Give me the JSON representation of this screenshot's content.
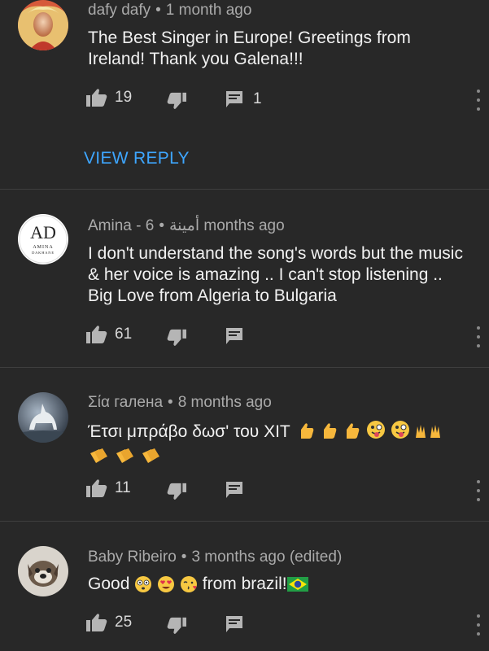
{
  "comments": [
    {
      "author": "dafy dafy",
      "time": "1 month ago",
      "text": "The Best Singer in Europe! Greetings from Ireland! Thank you Galena!!!",
      "likes": "19",
      "replies": "1",
      "view_reply": "VIEW REPLY",
      "avatar_icon": "avatar-photo"
    },
    {
      "author": "Amina - أمينة",
      "time": "6 months ago",
      "text": "I don't understand the song's words but the music & her voice is amazing .. I can't stop listening .. Big Love from  Algeria to Bulgaria",
      "likes": "61",
      "avatar_logo_letters": "AD",
      "avatar_logo_name": "AMINA",
      "avatar_logo_sub": "DAKHANE"
    },
    {
      "author": "Σία галена",
      "time": "8 months ago",
      "text": "Έτσι μπράβο δωσ'  του ΧΙΤ",
      "likes": "11",
      "avatar_icon": "unicorn-photo"
    },
    {
      "author": "Baby Ribeiro",
      "time": "3 months ago (edited)",
      "text_before": "Good",
      "text_after": "from brazil!",
      "likes": "25",
      "avatar_icon": "dog-photo"
    }
  ],
  "colors": {
    "background": "#282828",
    "link": "#3ea6ff",
    "meta": "#aaaaaa",
    "text": "#f1f1f1"
  }
}
